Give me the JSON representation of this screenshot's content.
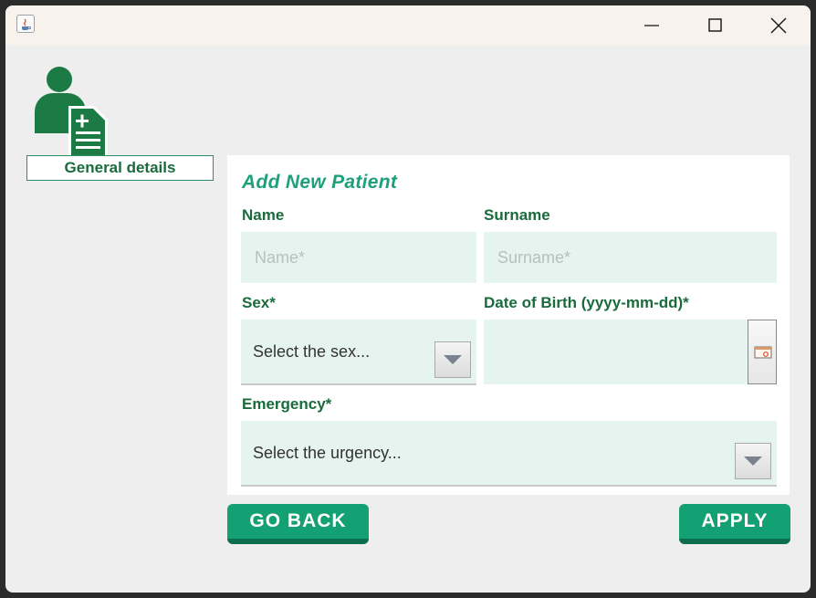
{
  "window": {
    "title": "",
    "controls": [
      "minimize-icon",
      "maximize-icon",
      "close-icon"
    ]
  },
  "sidebar": {
    "icon": "patient-record-icon",
    "tab_label": "General details"
  },
  "form": {
    "title": "Add New Patient",
    "name": {
      "label": "Name",
      "placeholder": "Name*",
      "value": ""
    },
    "surname": {
      "label": "Surname",
      "placeholder": "Surname*",
      "value": ""
    },
    "sex": {
      "label": "Sex*",
      "selected": "Select the sex..."
    },
    "dob": {
      "label": "Date of Birth (yyyy-mm-dd)*",
      "value": "",
      "icon": "calendar-icon"
    },
    "emergency": {
      "label": "Emergency*",
      "selected": "Select the urgency..."
    }
  },
  "actions": {
    "back_label": "GO BACK",
    "apply_label": "APPLY"
  },
  "colors": {
    "accent": "#13a073",
    "label": "#1a6b3c",
    "title": "#1ea07a",
    "field_bg": "#e6f4ef"
  }
}
